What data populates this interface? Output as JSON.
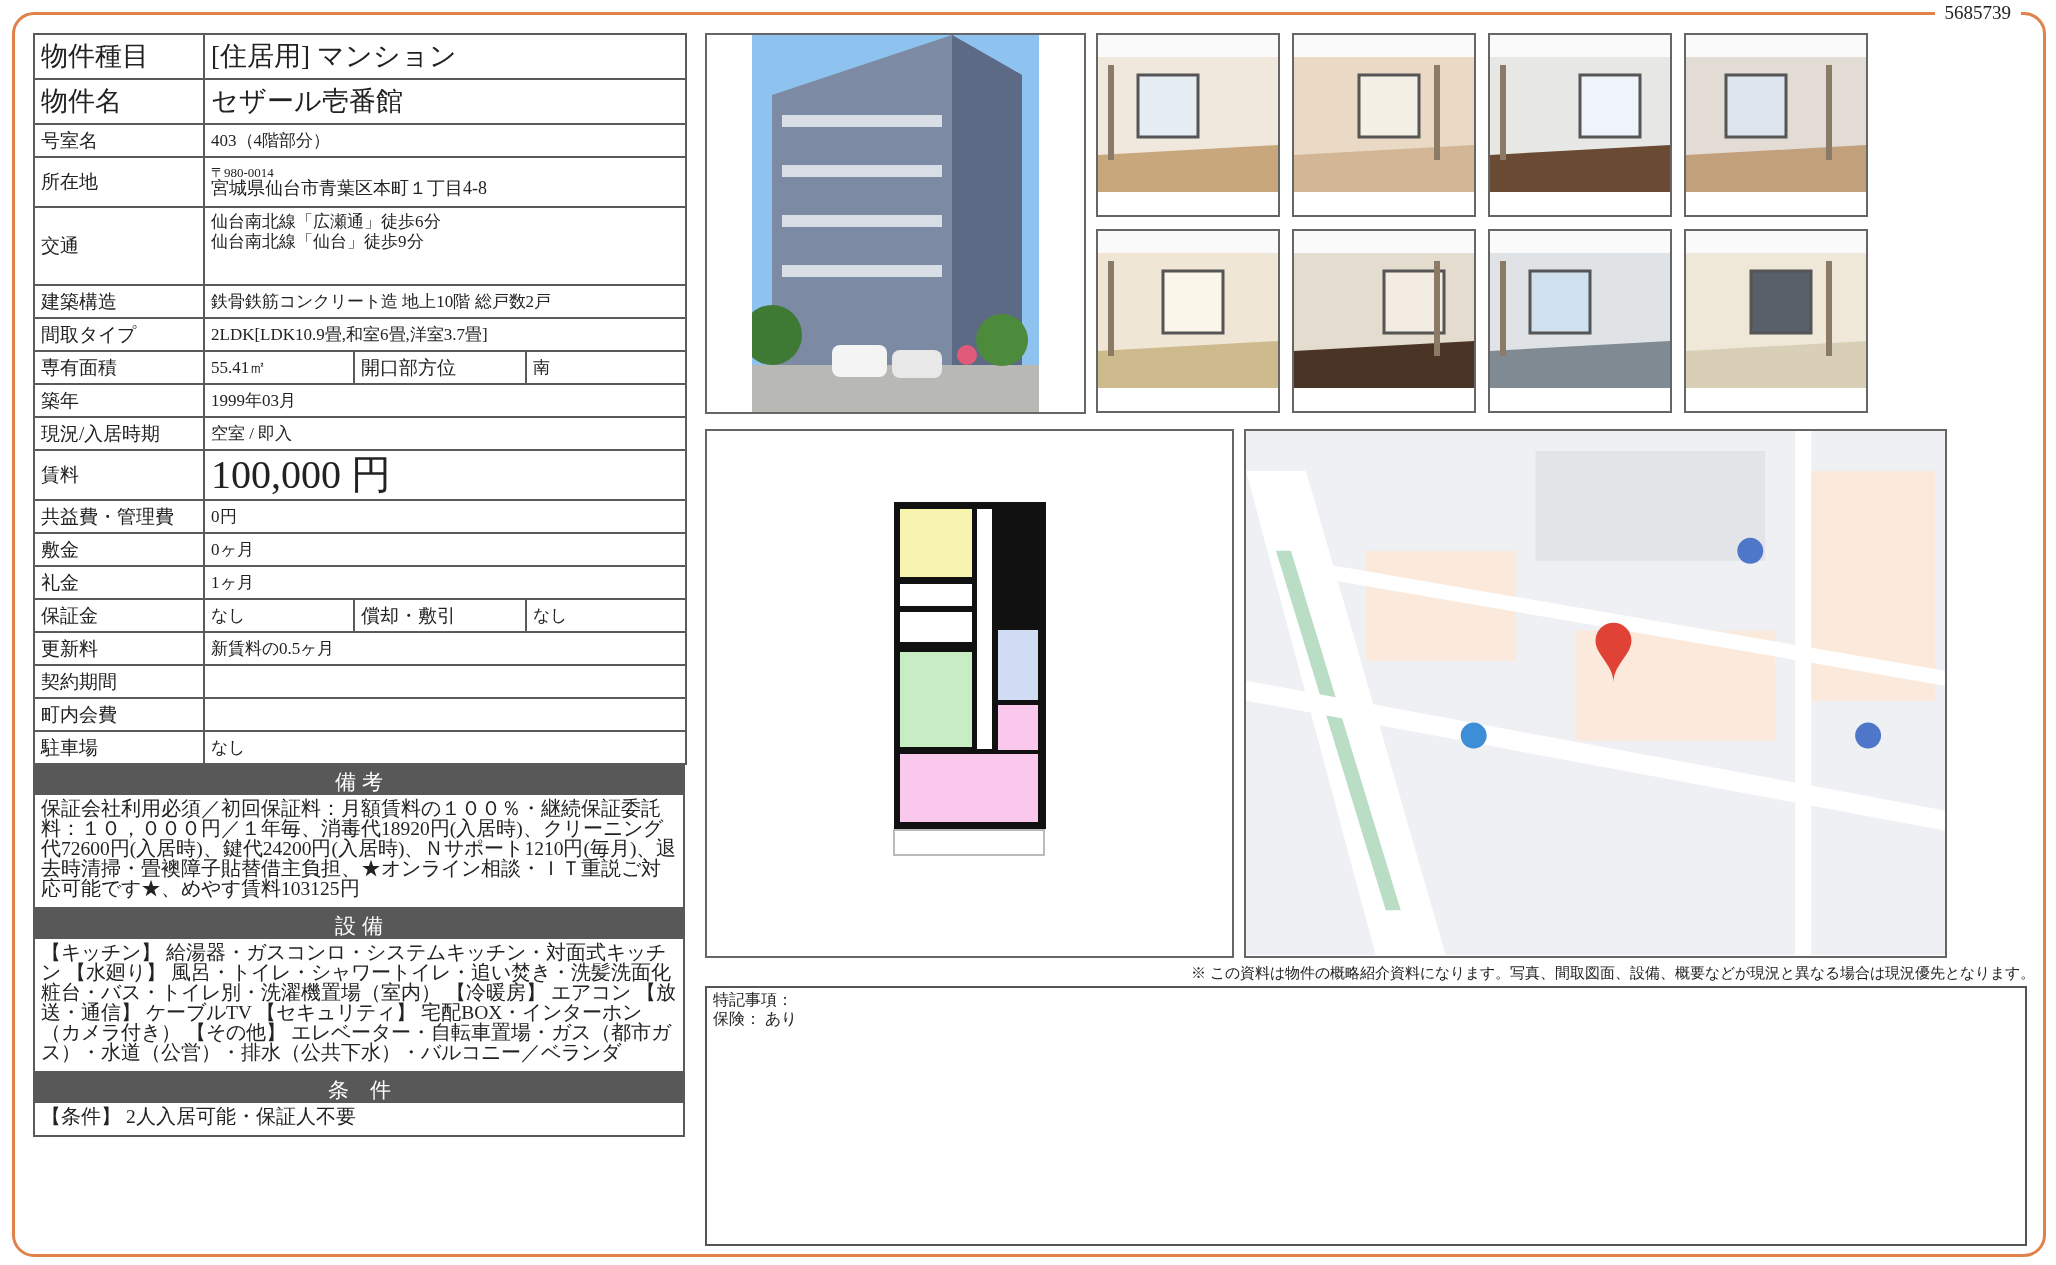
{
  "document_id": "5685739",
  "details": [
    {
      "kind": "title",
      "label": "物件種目",
      "value": "[住居用] マンション"
    },
    {
      "kind": "title",
      "label": "物件名",
      "value": "セザール壱番館"
    },
    {
      "kind": "plain",
      "label": "号室名",
      "value": "403（4階部分）"
    },
    {
      "kind": "address",
      "label": "所在地",
      "lines": [
        "〒980-0014",
        "宮城県仙台市青葉区本町１丁目4-8"
      ]
    },
    {
      "kind": "lines",
      "label": "交通",
      "lines": [
        "仙台南北線「広瀬通」徒歩6分",
        "仙台南北線「仙台」徒歩9分"
      ]
    },
    {
      "kind": "plain",
      "label": "建築構造",
      "value": "鉄骨鉄筋コンクリート造 地上10階 総戸数2戸"
    },
    {
      "kind": "plain",
      "label": "間取タイプ",
      "value": "2LDK[LDK10.9畳,和室6畳,洋室3.7畳]"
    },
    {
      "kind": "split",
      "label": "専有面積",
      "value": "55.41㎡",
      "label_2": "開口部方位",
      "value_2": "南"
    },
    {
      "kind": "plain",
      "label": "築年",
      "value": "1999年03月"
    },
    {
      "kind": "plain",
      "label": "現況/入居時期",
      "value": "空室 / 即入"
    },
    {
      "kind": "price",
      "label": "賃料",
      "value": "100,000 円"
    },
    {
      "kind": "plain",
      "label": "共益費・管理費",
      "value": "0円"
    },
    {
      "kind": "plain",
      "label": "敷金",
      "value": "0ヶ月"
    },
    {
      "kind": "plain",
      "label": "礼金",
      "value": "1ヶ月"
    },
    {
      "kind": "split",
      "label": "保証金",
      "value": "なし",
      "label_2": "償却・敷引",
      "value_2": "なし"
    },
    {
      "kind": "plain",
      "label": "更新料",
      "value": "新賃料の0.5ヶ月"
    },
    {
      "kind": "plain",
      "label": "契約期間"
    },
    {
      "kind": "plain",
      "label": "町内会費"
    },
    {
      "kind": "plain",
      "label": "駐車場",
      "value": "なし"
    }
  ],
  "sections": [
    {
      "heading": "備 考",
      "text": "保証会社利用必須／初回保証料：月額賃料の１００％・継続保証委託料：１０，０００円／１年毎、消毒代18920円(入居時)、クリーニング代72600円(入居時)、鍵代24200円(入居時)、Ｎサポート1210円(毎月)、退去時清掃・畳襖障子貼替借主負担、★オンライン相談・ＩＴ重説ご対応可能です★、めやす賃料103125円"
    },
    {
      "heading": "設 備",
      "text": "【キッチン】 給湯器・ガスコンロ・システムキッチン・対面式キッチン 【水廻り】 風呂・トイレ・シャワートイレ・追い焚き・洗髪洗面化粧台・バス・トイレ別・洗濯機置場（室内） 【冷暖房】 エアコン 【放送・通信】 ケーブルTV 【セキュリティ】 宅配BOX・インターホン（カメラ付き） 【その他】 エレベーター・自転車置場・ガス（都市ガス）・水道（公営）・排水（公共下水）・バルコニー／ベランダ"
    },
    {
      "heading": "条　件",
      "text": "【条件】 2人入居可能・保証人不要"
    }
  ],
  "notice": "※ この資料は物件の概略紹介資料になります。写真、間取図面、設備、概要などが現況と異なる場合は現況優先となります。",
  "special_notes": [
    "特記事項：",
    "保険： あり"
  ]
}
